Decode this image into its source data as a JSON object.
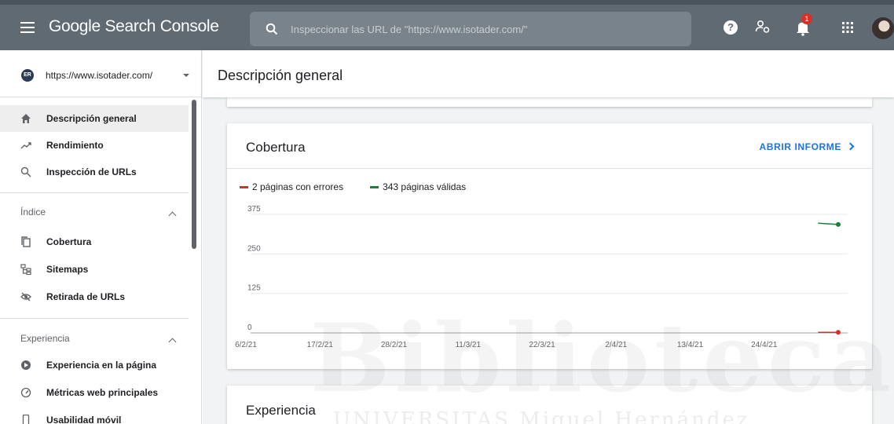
{
  "header": {
    "app_name": "Google Search Console",
    "search_placeholder": "Inspeccionar las URL de \"https://www.isotader.com/\"",
    "notifications_count": "1",
    "icons": [
      "menu-icon",
      "search-icon",
      "help-icon",
      "users-settings-icon",
      "notifications-icon",
      "apps-icon",
      "avatar"
    ]
  },
  "sidebar": {
    "property_url": "https://www.isotader.com/",
    "property_logo_text": "ER",
    "items_top": [
      {
        "label": "Descripción general",
        "icon": "home-icon",
        "active": true
      },
      {
        "label": "Rendimiento",
        "icon": "trending-up-icon",
        "active": false
      },
      {
        "label": "Inspección de URLs",
        "icon": "search-icon",
        "active": false
      }
    ],
    "section_index": {
      "label": "Índice",
      "items": [
        {
          "label": "Cobertura",
          "icon": "copy-icon"
        },
        {
          "label": "Sitemaps",
          "icon": "sitemap-icon"
        },
        {
          "label": "Retirada de URLs",
          "icon": "visibility-off-icon"
        }
      ]
    },
    "section_experience": {
      "label": "Experiencia",
      "items": [
        {
          "label": "Experiencia en la página",
          "icon": "page-experience-icon"
        },
        {
          "label": "Métricas web principales",
          "icon": "speed-icon"
        },
        {
          "label": "Usabilidad móvil",
          "icon": "smartphone-icon"
        }
      ]
    }
  },
  "main": {
    "page_title": "Descripción general",
    "coverage_card": {
      "title": "Cobertura",
      "link": "ABRIR INFORME"
    },
    "experience_card": {
      "title": "Experiencia"
    }
  },
  "watermark": {
    "line1": "Biblioteca",
    "line2": "UNIVERSITAS Miguel Hernández"
  },
  "colors": {
    "topbar": "#5f6a73",
    "error": "#d93025",
    "valid": "#188038",
    "link": "#1a73e8"
  },
  "chart_data": {
    "type": "line",
    "title": "",
    "x": [
      "6/2/21",
      "17/2/21",
      "28/2/21",
      "11/3/21",
      "22/3/21",
      "2/4/21",
      "13/4/21",
      "24/4/21"
    ],
    "ylim": [
      0,
      375
    ],
    "yticks": [
      0,
      125,
      250,
      375
    ],
    "grid": true,
    "legend_position": "top-left",
    "series": [
      {
        "name": "2 páginas con errores",
        "color": "#d93025",
        "points": [
          {
            "x": "2/5/21",
            "y": 2
          },
          {
            "x": "5/5/21",
            "y": 2
          }
        ]
      },
      {
        "name": "343 páginas válidas",
        "color": "#188038",
        "points": [
          {
            "x": "2/5/21",
            "y": 347
          },
          {
            "x": "5/5/21",
            "y": 343
          }
        ]
      }
    ]
  }
}
